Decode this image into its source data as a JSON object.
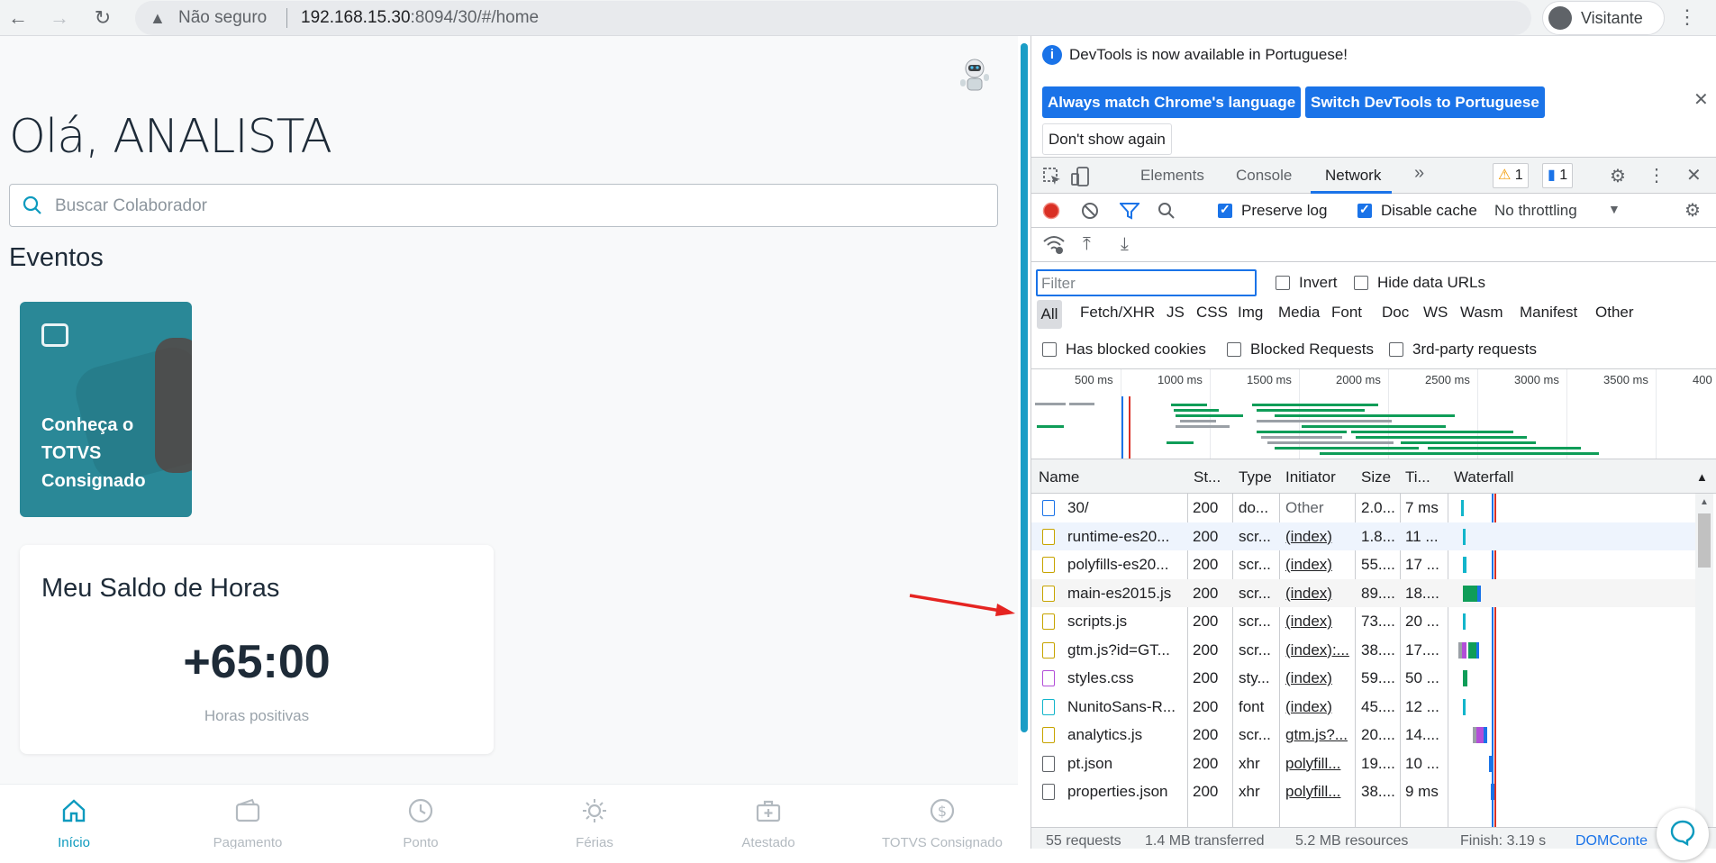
{
  "browser": {
    "address": {
      "security_label": "Não seguro",
      "host": "192.168.15.30",
      "path": ":8094/30/#/home"
    },
    "profile_label": "Visitante"
  },
  "app": {
    "greeting": "Olá, ANALISTA",
    "search_placeholder": "Buscar Colaborador",
    "events_title": "Eventos",
    "event_card_title": "Conheça o TOTVS Consignado",
    "saldo": {
      "title": "Meu Saldo de Horas",
      "value": "+65:00",
      "subtitle": "Horas positivas"
    },
    "nav": [
      {
        "label": "Início",
        "icon": "home-icon"
      },
      {
        "label": "Pagamento",
        "icon": "wallet-icon"
      },
      {
        "label": "Ponto",
        "icon": "clock-icon"
      },
      {
        "label": "Férias",
        "icon": "sun-icon"
      },
      {
        "label": "Atestado",
        "icon": "medical-kit-icon"
      },
      {
        "label": "TOTVS Consignado",
        "icon": "dollar-icon"
      }
    ]
  },
  "devtools": {
    "infobar": {
      "message": "DevTools is now available in Portuguese!",
      "btn_match": "Always match Chrome's language",
      "btn_switch": "Switch DevTools to Portuguese",
      "btn_dont_show": "Don't show again"
    },
    "tabs": [
      "Elements",
      "Console",
      "Network"
    ],
    "warnings_count": "1",
    "messages_count": "1",
    "toolbar": {
      "preserve_log": "Preserve log",
      "disable_cache": "Disable cache",
      "throttling": "No throttling"
    },
    "filter": {
      "placeholder": "Filter",
      "invert": "Invert",
      "hide_data_urls": "Hide data URLs",
      "types": [
        "All",
        "Fetch/XHR",
        "JS",
        "CSS",
        "Img",
        "Media",
        "Font",
        "Doc",
        "WS",
        "Wasm",
        "Manifest",
        "Other"
      ],
      "has_blocked_cookies": "Has blocked cookies",
      "blocked_requests": "Blocked Requests",
      "third_party": "3rd-party requests"
    },
    "timeline_ticks": [
      "500 ms",
      "1000 ms",
      "1500 ms",
      "2000 ms",
      "2500 ms",
      "3000 ms",
      "3500 ms",
      "400"
    ],
    "columns": [
      "Name",
      "St...",
      "Type",
      "Initiator",
      "Size",
      "Ti...",
      "Waterfall"
    ],
    "rows": [
      {
        "name": "30/",
        "status": "200",
        "type": "do...",
        "initiator": "Other",
        "size": "2.0...",
        "time": "7 ms",
        "kind": "doc"
      },
      {
        "name": "runtime-es20...",
        "status": "200",
        "type": "scr...",
        "initiator": "(index)",
        "size": "1.8...",
        "time": "11 ...",
        "kind": "js"
      },
      {
        "name": "polyfills-es20...",
        "status": "200",
        "type": "scr...",
        "initiator": "(index)",
        "size": "55....",
        "time": "17 ...",
        "kind": "js"
      },
      {
        "name": "main-es2015.js",
        "status": "200",
        "type": "scr...",
        "initiator": "(index)",
        "size": "89....",
        "time": "18....",
        "kind": "js"
      },
      {
        "name": "scripts.js",
        "status": "200",
        "type": "scr...",
        "initiator": "(index)",
        "size": "73....",
        "time": "20 ...",
        "kind": "js"
      },
      {
        "name": "gtm.js?id=GT...",
        "status": "200",
        "type": "scr...",
        "initiator": "(index):...",
        "size": "38....",
        "time": "17....",
        "kind": "js"
      },
      {
        "name": "styles.css",
        "status": "200",
        "type": "sty...",
        "initiator": "(index)",
        "size": "59....",
        "time": "50 ...",
        "kind": "css"
      },
      {
        "name": "NunitoSans-R...",
        "status": "200",
        "type": "font",
        "initiator": "(index)",
        "size": "45....",
        "time": "12 ...",
        "kind": "font"
      },
      {
        "name": "analytics.js",
        "status": "200",
        "type": "scr...",
        "initiator": "gtm.js?...",
        "size": "20....",
        "time": "14....",
        "kind": "js"
      },
      {
        "name": "pt.json",
        "status": "200",
        "type": "xhr",
        "initiator": "polyfill...",
        "size": "19....",
        "time": "10 ...",
        "kind": "json"
      },
      {
        "name": "properties.json",
        "status": "200",
        "type": "xhr",
        "initiator": "polyfill...",
        "size": "38....",
        "time": "9 ms",
        "kind": "json"
      }
    ],
    "status_bar": {
      "requests": "55 requests",
      "transferred": "1.4 MB transferred",
      "resources": "5.2 MB resources",
      "finish": "Finish: 3.19 s",
      "dom": "DOMConte"
    }
  }
}
